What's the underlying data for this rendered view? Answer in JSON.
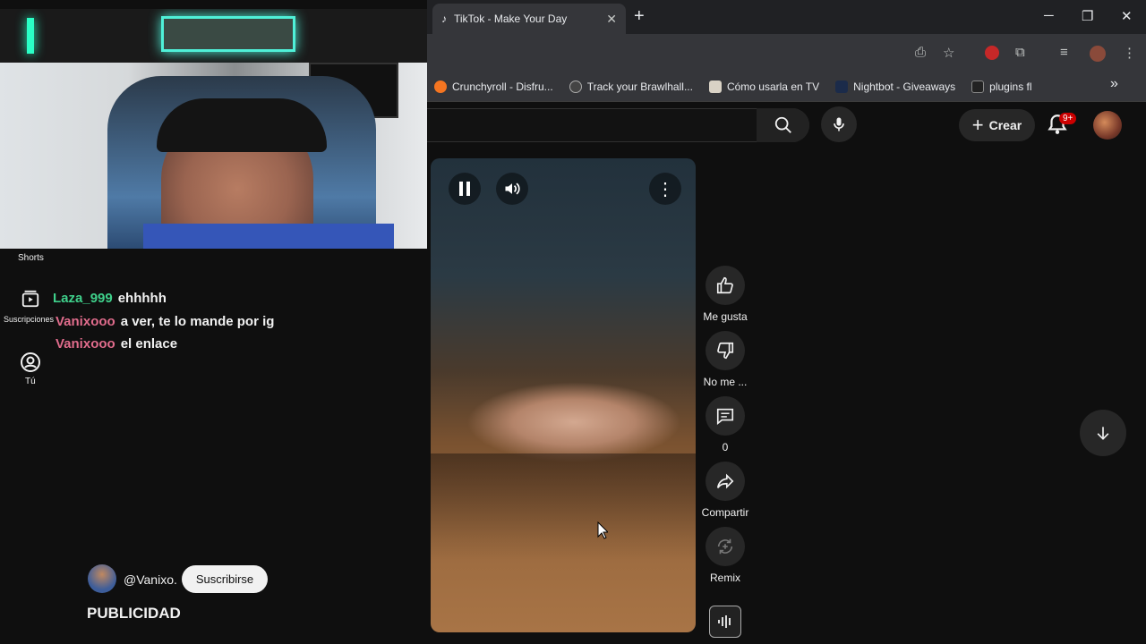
{
  "browser": {
    "tab_title": "TikTok - Make Your Day",
    "tab_close": "✕",
    "new_tab": "+",
    "window": {
      "minimize": "─",
      "maximize": "❐",
      "close": "✕"
    },
    "bookmarks": [
      {
        "label": "Crunchyroll - Disfru...",
        "color": "#f47521"
      },
      {
        "label": "Track your Brawlhall...",
        "color": "#444444"
      },
      {
        "label": "Cómo usarla en TV",
        "color": "#d9d2c5"
      },
      {
        "label": "Nightbot - Giveaways",
        "color": "#1b2b4a"
      },
      {
        "label": "plugins fl",
        "color": "#222222"
      }
    ],
    "bookmarks_more": "»"
  },
  "header": {
    "create_label": "Crear",
    "notification_badge": "9+"
  },
  "sidebar": {
    "shorts_label": "Shorts",
    "subscriptions_label": "Suscripciones",
    "you_label": "Tú"
  },
  "chat": [
    {
      "name": "Laza_999",
      "message": "ehhhhh",
      "color": "#3fd08b"
    },
    {
      "name": "Vanixooo",
      "message": "a ver, te lo mande por ig",
      "color": "#e06c8c"
    },
    {
      "name": "Vanixooo",
      "message": "el enlace",
      "color": "#e06c8c"
    }
  ],
  "short": {
    "channel_handle": "@Vanixo.",
    "subscribe_label": "Suscribirse",
    "caption": "PUBLICIDAD"
  },
  "actions": {
    "like_label": "Me gusta",
    "dislike_label": "No me ...",
    "comments_count": "0",
    "share_label": "Compartir",
    "remix_label": "Remix"
  }
}
